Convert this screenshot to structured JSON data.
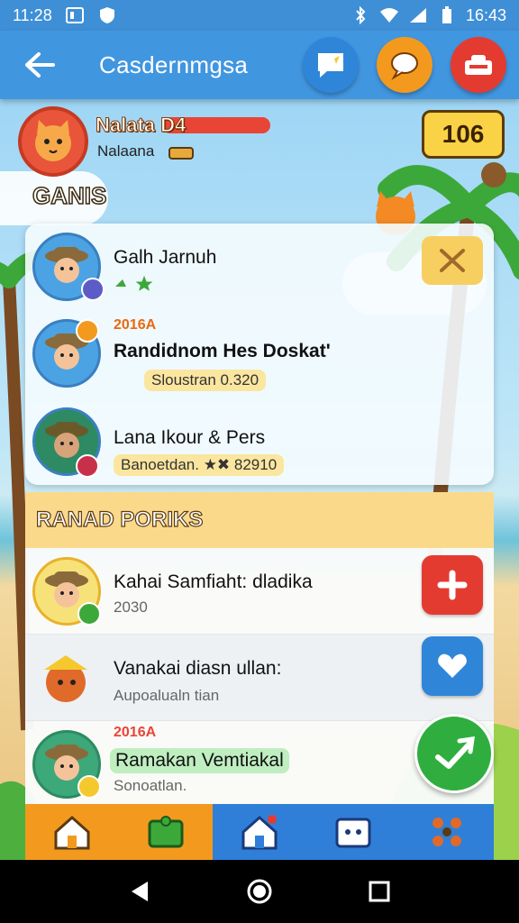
{
  "status_bar": {
    "time_left": "11:28",
    "time_right": "16:43"
  },
  "app_bar": {
    "title": "Casdernmgsa"
  },
  "player": {
    "name": "Nalata",
    "level": "D4",
    "subtitle": "Nalaana",
    "coins": "106"
  },
  "section_title": "GANIS",
  "friends": [
    {
      "title": "Galh Jarnuh",
      "subtitle": ""
    },
    {
      "tag": "2016A",
      "title": "Randidnom Hes Doskat'",
      "subtitle": "Sloustran 0.320"
    },
    {
      "title": "Lana Ikour & Pers",
      "subtitle": "Banoetdan. ★✖ 82910"
    }
  ],
  "ranked": {
    "header": "RANAD PORIKS",
    "rows": [
      {
        "title": "Kahai Samfiaht: dladika",
        "subtitle": "2030",
        "action": "add"
      },
      {
        "title": "Vanakai diasn ullan:",
        "subtitle": "Aupoalualn tian",
        "action": "like"
      },
      {
        "tag": "2016A",
        "title": "Ramakan Vemtiakal",
        "subtitle": "Sonoatlan."
      }
    ]
  },
  "colors": {
    "appbar": "#4196e0",
    "accent_orange": "#f39a1e",
    "accent_red": "#e43b31",
    "accent_green": "#2fae3f",
    "accent_blue": "#2f86d8"
  },
  "icons": {
    "top_actions": [
      "chat-icon",
      "message-icon",
      "gift-icon"
    ],
    "bottom_nav": [
      "home-icon",
      "puzzle-icon",
      "house-icon",
      "cards-icon",
      "grid-icon"
    ]
  }
}
